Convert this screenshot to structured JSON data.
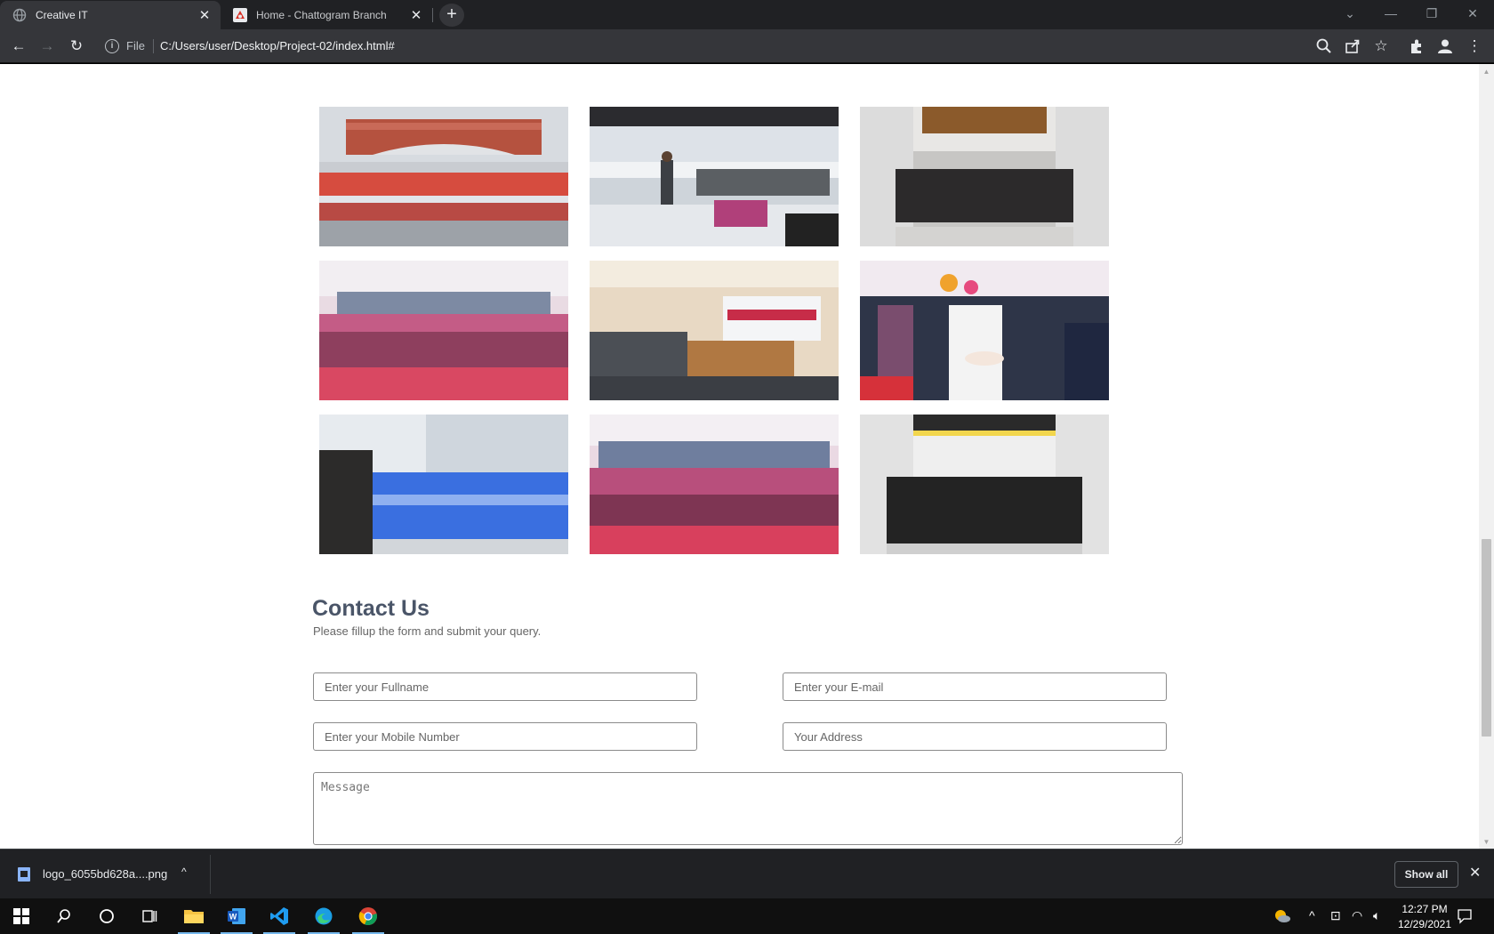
{
  "browser": {
    "tabs": [
      {
        "title": "Creative IT",
        "active": true
      },
      {
        "title": "Home - Chattogram Branch",
        "active": false
      }
    ],
    "omnibox": {
      "scheme": "File",
      "url": "C:/Users/user/Desktop/Project-02/index.html#"
    }
  },
  "page": {
    "contact": {
      "title": "Contact Us",
      "subtitle": "Please fillup the form and submit your query.",
      "fields": {
        "fullname_placeholder": "Enter your Fullname",
        "email_placeholder": "Enter your E-mail",
        "mobile_placeholder": "Enter your Mobile Number",
        "address_placeholder": "Your Address",
        "message_placeholder": "Message"
      }
    }
  },
  "downloads": {
    "file_name": "logo_6055bd628a....png",
    "show_all_label": "Show all"
  },
  "taskbar": {
    "time": "12:27 PM",
    "date": "12/29/2021"
  },
  "colors": {
    "accent": "#4285f4",
    "heading": "#4a5568"
  }
}
